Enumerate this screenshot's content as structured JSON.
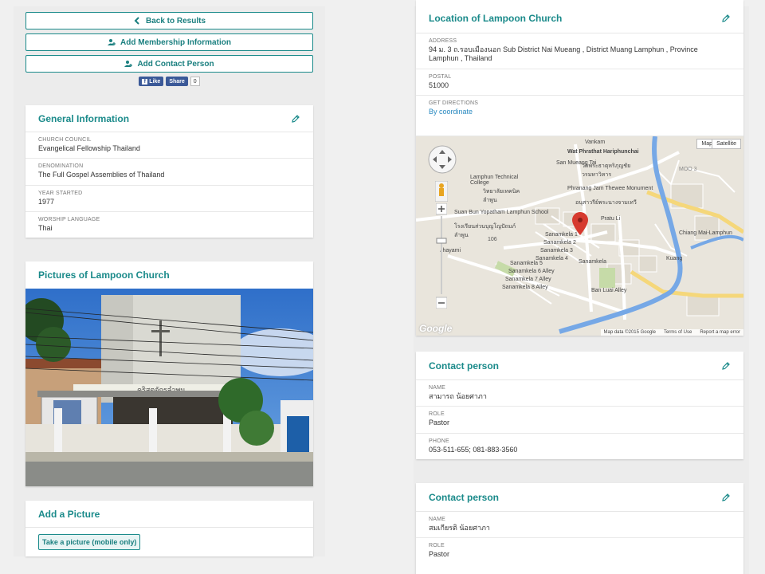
{
  "actions": {
    "back": "Back to Results",
    "add_membership": "Add Membership Information",
    "add_contact": "Add Contact Person"
  },
  "social": {
    "like": "Like",
    "share": "Share",
    "count": "0"
  },
  "general": {
    "title": "General Information",
    "fields": [
      {
        "label": "CHURCH COUNCIL",
        "value": "Evangelical Fellowship Thailand"
      },
      {
        "label": "DENOMINATION",
        "value": "The Full Gospel Assemblies of Thailand"
      },
      {
        "label": "YEAR STARTED",
        "value": "1977"
      },
      {
        "label": "WORSHIP LANGUAGE",
        "value": "Thai"
      }
    ]
  },
  "pictures": {
    "title": "Pictures of Lampoon Church",
    "sign_text": "คริสตจักรลำพูน"
  },
  "add_picture": {
    "title": "Add a Picture",
    "button": "Take a picture (mobile only)"
  },
  "location": {
    "title": "Location of Lampoon Church",
    "address_label": "ADDRESS",
    "address": "94 ม. 3 ถ.รอบเมืองนอก Sub District Nai Mueang , District Muang Lamphun , Province Lamphun , Thailand",
    "postal_label": "POSTAL",
    "postal": "51000",
    "directions_label": "GET DIRECTIONS",
    "directions_link": "By coordinate"
  },
  "map": {
    "map_btn": "Map",
    "satellite_btn": "Satellite",
    "labels": [
      "Wat Phrathat Hariphunchai",
      "วัดพระธาตุหริภุญชัย วรมหาวิหาร",
      "Lamphun Technical College",
      "วิทยาลัยเทคนิคลำพูน",
      "Phranang Jam Thewee Monument",
      "อนุสาวรีย์พระนางจามเทวี",
      "Suan Bun Yopatham Lamphun School",
      "โรงเรียนส่วนบุญโญปัถมภ์ ลำพูน",
      "Vankam",
      "MOO 3",
      "Sanamkela 1",
      "Sanamkela 2",
      "Sanamkela 3",
      "Sanamkela 4",
      "Sanamkela 5",
      "Sanamkela 6 Alley",
      "Sanamkela 7 Alley",
      "Sanamkela 8 Alley",
      "Ban Luai Alley",
      "Pratu Li",
      "Chiang Mai-Lamphun",
      "Sanamkela",
      "Kuang",
      "Jhayami",
      "San Mueang Tai",
      "106"
    ],
    "footer": [
      "Map data ©2015 Google",
      "Terms of Use",
      "Report a map error"
    ],
    "logo": "Google"
  },
  "contacts": [
    {
      "title": "Contact person",
      "name_label": "NAME",
      "name": "สามารถ น้อยศาภา",
      "role_label": "ROLE",
      "role": "Pastor",
      "phone_label": "PHONE",
      "phone": "053-511-655; 081-883-3560"
    },
    {
      "title": "Contact person",
      "name_label": "NAME",
      "name": "สมเกียรติ น้อยศาภา",
      "role_label": "ROLE",
      "role": "Pastor"
    }
  ],
  "colors": {
    "accent": "#1a8a8a",
    "link": "#2a8ac0",
    "marker": "#d63a2f"
  }
}
